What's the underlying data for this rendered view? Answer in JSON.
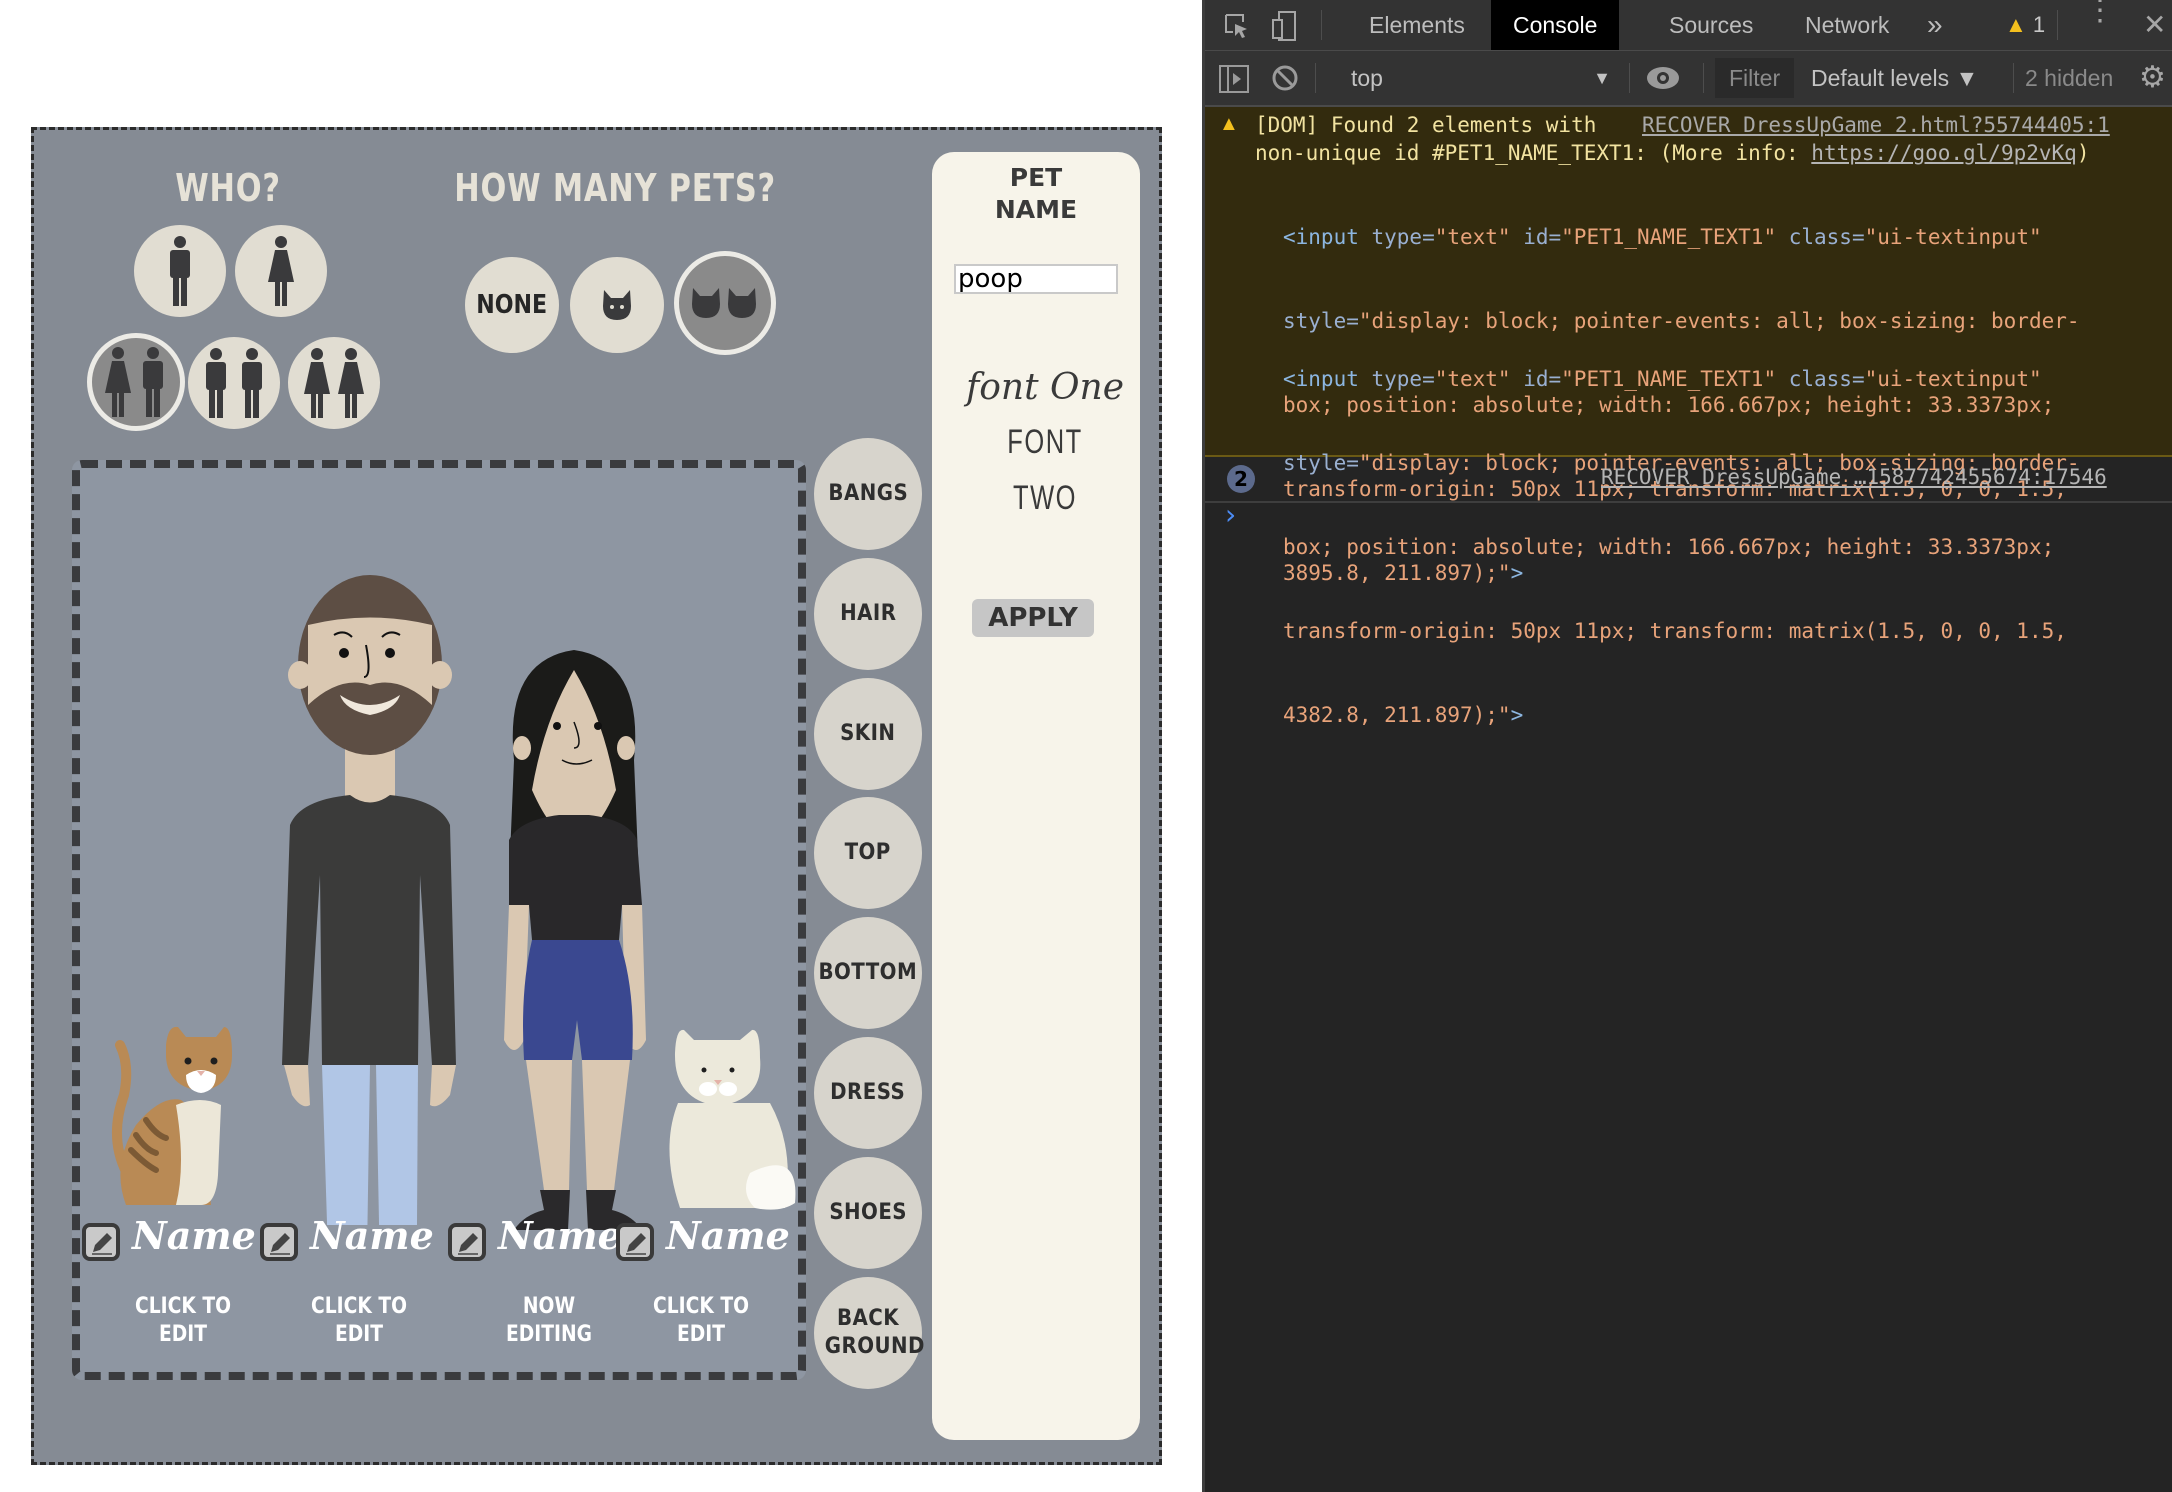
{
  "game": {
    "who_heading": "WHO?",
    "pets_heading": "HOW MANY PETS?",
    "who_options": [
      {
        "icon": "man-icon",
        "selected": false
      },
      {
        "icon": "woman-icon",
        "selected": false
      },
      {
        "icon": "woman-man-icon",
        "selected": true
      },
      {
        "icon": "two-men-icon",
        "selected": false
      },
      {
        "icon": "two-women-icon",
        "selected": false
      }
    ],
    "pet_options": [
      {
        "label": "NONE",
        "selected": false
      },
      {
        "icon": "one-cat-icon",
        "selected": false
      },
      {
        "icon": "two-cats-icon",
        "selected": true
      }
    ],
    "categories": [
      "BANGS",
      "HAIR",
      "SKIN",
      "TOP",
      "BOTTOM",
      "DRESS",
      "SHOES",
      "BACK GROUND"
    ],
    "pet_panel": {
      "title_line1": "PET",
      "title_line2": "NAME",
      "name_value": "poop",
      "font_one": "font One",
      "font_two": "FONT TWO",
      "apply": "APPLY"
    },
    "slots": [
      {
        "name": "Name",
        "status_line1": "CLICK TO",
        "status_line2": "EDIT"
      },
      {
        "name": "Name",
        "status_line1": "CLICK TO",
        "status_line2": "EDIT"
      },
      {
        "name": "Name",
        "status_line1": "NOW",
        "status_line2": "EDITING"
      },
      {
        "name": "Name",
        "status_line1": "CLICK TO",
        "status_line2": "EDIT"
      }
    ],
    "colors": {
      "frame_bg": "#858b94",
      "inner_bg": "#8e96a2",
      "button_bg": "#e1ddd2",
      "selected_bg": "#8a8a8a",
      "panel_bg": "#f7f4ea",
      "skin": "#dac8b2",
      "man_hair": "#5d4e44",
      "man_shirt": "#3b3b3a",
      "man_jeans": "#b1c6e6",
      "woman_hair": "#1b1b19",
      "woman_top": "#29282a",
      "woman_shorts": "#3a4890",
      "boots": "#2a292b",
      "tabby": "#b98a55",
      "white_cat": "#ece9db"
    }
  },
  "devtools": {
    "tabs": [
      "Elements",
      "Console",
      "Sources",
      "Network"
    ],
    "active_tab": "Console",
    "more_tabs": "»",
    "warning_count": "1",
    "context": "top",
    "filter_placeholder": "Filter",
    "levels": "Default levels ▼",
    "hidden": "2 hidden",
    "messages": {
      "warn_line1": "[DOM] Found 2 elements with",
      "warn_source": "RECOVER DressUpGame 2.html?55744405:1",
      "warn_line2_prefix": "non-unique id #PET1_NAME_TEXT1: (More info: ",
      "warn_link": "https://goo.gl/9p2vKq",
      "warn_line2_suffix": ")",
      "element1": {
        "open": "<input",
        "type_attr": " type=",
        "type_val": "\"text\"",
        "id_attr": " id=",
        "id_val": "\"PET1_NAME_TEXT1\"",
        "class_attr": " class=",
        "class_val": "\"ui-textinput\"",
        "style_attr": "style=",
        "style_l1": "\"display: block; pointer-events: all; box-sizing: border-",
        "style_l2": "box; position: absolute; width: 166.667px; height: 33.3373px;",
        "style_l3": "transform-origin: 50px 11px; transform: matrix(1.5, 0, 0, 1.5,",
        "style_l4": "3895.8, 211.897);\"",
        "close": ">"
      },
      "element2": {
        "open": "<input",
        "type_attr": " type=",
        "type_val": "\"text\"",
        "id_attr": " id=",
        "id_val": "\"PET1_NAME_TEXT1\"",
        "class_attr": " class=",
        "class_val": "\"ui-textinput\"",
        "style_attr": "style=",
        "style_l1": "\"display: block; pointer-events: all; box-sizing: border-",
        "style_l2": "box; position: absolute; width: 166.667px; height: 33.3373px;",
        "style_l3": "transform-origin: 50px 11px; transform: matrix(1.5, 0, 0, 1.5,",
        "style_l4": "4382.8, 211.897);\"",
        "close": ">"
      },
      "repeat_count": "2",
      "repeat_source": "RECOVER DressUpGame …1587742455674:17546"
    },
    "prompt": "›"
  }
}
